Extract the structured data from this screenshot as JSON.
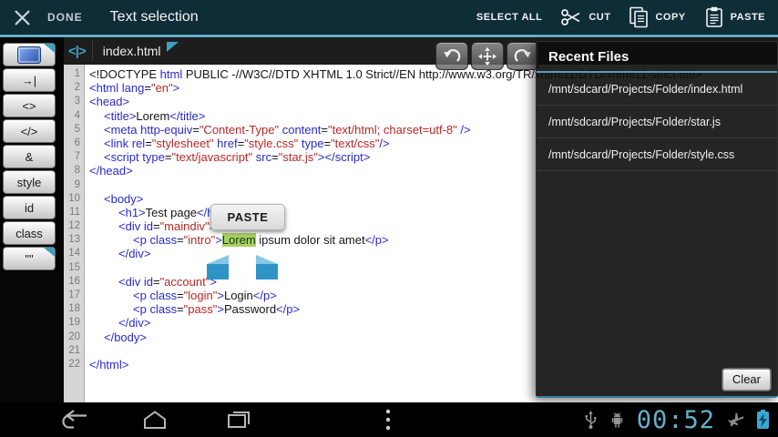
{
  "action_bar": {
    "done_label": "DONE",
    "title": "Text selection",
    "select_all_label": "SELECT ALL",
    "cut_label": "CUT",
    "copy_label": "COPY",
    "paste_label": "PASTE"
  },
  "sidebar": {
    "buttons": [
      {
        "name": "selection",
        "label": "",
        "icon": "blue-image-icon",
        "fold": true
      },
      {
        "name": "tab",
        "label": "→|"
      },
      {
        "name": "angle-brackets",
        "label": "<>"
      },
      {
        "name": "close-tag",
        "label": "</>"
      },
      {
        "name": "ampersand",
        "label": "&"
      },
      {
        "name": "style",
        "label": "style"
      },
      {
        "name": "id",
        "label": "id"
      },
      {
        "name": "class",
        "label": "class"
      },
      {
        "name": "quotes",
        "label": "\"\"",
        "fold": true
      }
    ]
  },
  "editor": {
    "tab": {
      "icon_glyph": "<|>",
      "file_name": "index.html"
    },
    "selection_popup": {
      "label": "PASTE"
    },
    "selection_text": "Lorem",
    "lines": [
      {
        "indent": 0,
        "segments": [
          [
            "plain",
            "<!DOCTYPE "
          ],
          [
            "tag",
            "html"
          ],
          [
            "plain",
            " PUBLIC -//W3C//DTD XHTML 1.0 Strict//EN http://www.w3.org/TR/xhtml11/DTD/xhtml11-strict.dtd>"
          ]
        ]
      },
      {
        "indent": 0,
        "segments": [
          [
            "tag",
            "<html"
          ],
          [
            "plain",
            " "
          ],
          [
            "tag",
            "lang"
          ],
          [
            "plain",
            "="
          ],
          [
            "str",
            "\"en\""
          ],
          [
            "tag",
            ">"
          ]
        ]
      },
      {
        "indent": 0,
        "segments": [
          [
            "tag",
            "<head>"
          ]
        ]
      },
      {
        "indent": 1,
        "segments": [
          [
            "tag",
            "<title>"
          ],
          [
            "plain",
            "Lorem"
          ],
          [
            "tag",
            "</title>"
          ]
        ]
      },
      {
        "indent": 1,
        "segments": [
          [
            "tag",
            "<meta"
          ],
          [
            "plain",
            " "
          ],
          [
            "tag",
            "http-equiv"
          ],
          [
            "plain",
            "="
          ],
          [
            "str",
            "\"Content-Type\""
          ],
          [
            "plain",
            " "
          ],
          [
            "tag",
            "content"
          ],
          [
            "plain",
            "="
          ],
          [
            "str",
            "\"text/html; charset=utf-8\""
          ],
          [
            "plain",
            " "
          ],
          [
            "tag",
            "/>"
          ]
        ]
      },
      {
        "indent": 1,
        "segments": [
          [
            "tag",
            "<link"
          ],
          [
            "plain",
            " "
          ],
          [
            "tag",
            "rel"
          ],
          [
            "plain",
            "="
          ],
          [
            "str",
            "\"stylesheet\""
          ],
          [
            "plain",
            " "
          ],
          [
            "tag",
            "href"
          ],
          [
            "plain",
            "="
          ],
          [
            "str",
            "\"style.css\""
          ],
          [
            "plain",
            " "
          ],
          [
            "tag",
            "type"
          ],
          [
            "plain",
            "="
          ],
          [
            "str",
            "\"text/css\""
          ],
          [
            "tag",
            "/>"
          ]
        ]
      },
      {
        "indent": 1,
        "segments": [
          [
            "tag",
            "<script"
          ],
          [
            "plain",
            " "
          ],
          [
            "tag",
            "type"
          ],
          [
            "plain",
            "="
          ],
          [
            "str",
            "\"text/javascript\""
          ],
          [
            "plain",
            " "
          ],
          [
            "tag",
            "src"
          ],
          [
            "plain",
            "="
          ],
          [
            "str",
            "\"star.js\""
          ],
          [
            "tag",
            "></script>"
          ]
        ]
      },
      {
        "indent": 0,
        "segments": [
          [
            "tag",
            "</head>"
          ]
        ]
      },
      {
        "indent": 0,
        "segments": []
      },
      {
        "indent": 1,
        "segments": [
          [
            "tag",
            "<body>"
          ]
        ]
      },
      {
        "indent": 2,
        "segments": [
          [
            "tag",
            "<h1>"
          ],
          [
            "plain",
            "Test page"
          ],
          [
            "tag",
            "</h1>"
          ]
        ]
      },
      {
        "indent": 2,
        "segments": [
          [
            "tag",
            "<div"
          ],
          [
            "plain",
            " "
          ],
          [
            "tag",
            "id"
          ],
          [
            "plain",
            "="
          ],
          [
            "str",
            "\"maindiv\""
          ],
          [
            "tag",
            ">"
          ]
        ]
      },
      {
        "indent": 3,
        "segments": [
          [
            "tag",
            "<p"
          ],
          [
            "plain",
            " "
          ],
          [
            "tag",
            "class"
          ],
          [
            "plain",
            "="
          ],
          [
            "str",
            "\"intro\""
          ],
          [
            "tag",
            ">"
          ],
          [
            "sel",
            "Lorem"
          ],
          [
            "plain",
            " ipsum dolor sit amet"
          ],
          [
            "tag",
            "</p>"
          ]
        ]
      },
      {
        "indent": 2,
        "segments": [
          [
            "tag",
            "</div>"
          ]
        ]
      },
      {
        "indent": 0,
        "segments": []
      },
      {
        "indent": 2,
        "segments": [
          [
            "tag",
            "<div"
          ],
          [
            "plain",
            " "
          ],
          [
            "tag",
            "id"
          ],
          [
            "plain",
            "="
          ],
          [
            "str",
            "\"account\""
          ],
          [
            "tag",
            ">"
          ]
        ]
      },
      {
        "indent": 3,
        "segments": [
          [
            "tag",
            "<p"
          ],
          [
            "plain",
            " "
          ],
          [
            "tag",
            "class"
          ],
          [
            "plain",
            "="
          ],
          [
            "str",
            "\"login\""
          ],
          [
            "tag",
            ">"
          ],
          [
            "plain",
            "Login"
          ],
          [
            "tag",
            "</p>"
          ]
        ]
      },
      {
        "indent": 3,
        "segments": [
          [
            "tag",
            "<p"
          ],
          [
            "plain",
            " "
          ],
          [
            "tag",
            "class"
          ],
          [
            "plain",
            "="
          ],
          [
            "str",
            "\"pass\""
          ],
          [
            "tag",
            ">"
          ],
          [
            "plain",
            "Password"
          ],
          [
            "tag",
            "</p>"
          ]
        ]
      },
      {
        "indent": 2,
        "segments": [
          [
            "tag",
            "</div>"
          ]
        ]
      },
      {
        "indent": 1,
        "segments": [
          [
            "tag",
            "</body>"
          ]
        ]
      },
      {
        "indent": 0,
        "segments": []
      },
      {
        "indent": 0,
        "segments": [
          [
            "tag",
            "</html>"
          ]
        ]
      }
    ]
  },
  "recent_files": {
    "title": "Recent Files",
    "items": [
      "/mnt/sdcard/Projects/Folder/index.html",
      "/mnt/sdcard/Projects/Folder/star.js",
      "/mnt/sdcard/Projects/Folder/style.css"
    ],
    "clear_label": "Clear"
  },
  "system_bar": {
    "clock": "00:52"
  },
  "icons": {
    "close": "x-cross",
    "cut": "scissors",
    "copy": "stacked-pages",
    "paste": "clipboard",
    "undo": "curved-arrow-left",
    "move": "four-way-arrows",
    "redo": "curved-arrow-right",
    "back": "back-arrow",
    "home": "house-outline",
    "recents": "stacked-windows",
    "menu": "three-dots",
    "usb": "usb-trident",
    "adb": "android-robot",
    "airplane": "airplane",
    "battery": "battery-charging"
  },
  "colors": {
    "action_bar_bg": "#0f2d37",
    "accent_blue": "#9adcf5",
    "teal_icon": "#3f9fbf",
    "syntax_tag": "#2929cf",
    "syntax_string": "#bb2626",
    "syntax_text": "#161616",
    "selection_highlight": "#a9d162",
    "handle_blue": "#2e94c6",
    "clock_blue": "#63b1cb"
  }
}
